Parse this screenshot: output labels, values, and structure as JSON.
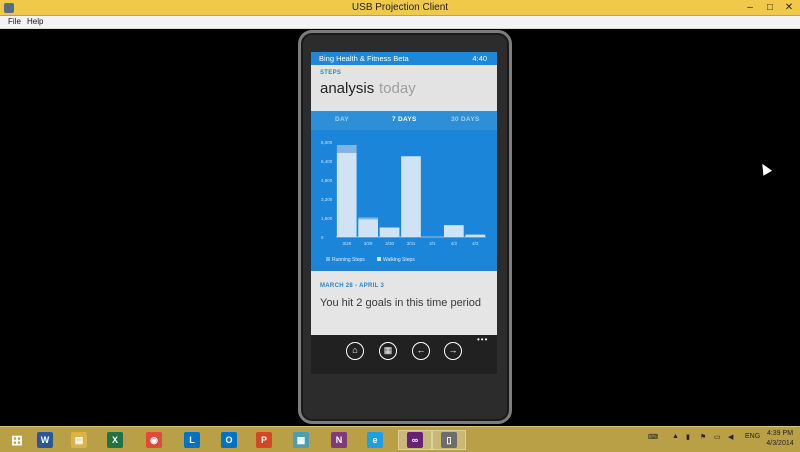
{
  "window": {
    "title": "USB Projection Client",
    "min_glyph": "–",
    "max_glyph": "□",
    "close_glyph": "✕"
  },
  "menu": [
    "File",
    "Help"
  ],
  "phone": {
    "status": {
      "app_name": "Bing Health & Fitness Beta",
      "time": "4:40"
    },
    "section_label": "STEPS",
    "pivot_active": "analysis",
    "pivot_inactive": "today",
    "tabs": [
      "DAY",
      "7 DAYS",
      "30 DAYS"
    ],
    "summary_range": "MARCH 28 - APRIL 3",
    "summary_message": "You hit 2 goals in this time period",
    "app_bar": {
      "icons": [
        "home-icon",
        "calendar-icon",
        "back-arrow-icon",
        "forward-arrow-icon"
      ],
      "more": "•••"
    }
  },
  "chart_data": {
    "type": "bar",
    "categories": [
      "3/28",
      "3/29",
      "3/30",
      "3/31",
      "4/1",
      "4/2",
      "4/3"
    ],
    "series": [
      {
        "name": "Running Steps",
        "values": [
          650,
          150,
          0,
          0,
          0,
          0,
          0
        ]
      },
      {
        "name": "Walking Steps",
        "values": [
          7100,
          1500,
          800,
          6800,
          0,
          1000,
          200
        ]
      }
    ],
    "yticks": [
      "8,000",
      "6,400",
      "4,800",
      "3,200",
      "1,600",
      "0"
    ],
    "ylim": [
      0,
      8000
    ],
    "legend": [
      "Running Steps",
      "Walking Steps"
    ],
    "colors": {
      "running": "#7fb5e6",
      "walking": "#cfe3f4",
      "background": "#1b85d9",
      "axis": "#bcd9f2"
    }
  },
  "taskbar": {
    "apps": [
      {
        "name": "windows-start",
        "glyph": "⊞",
        "color": "transparent"
      },
      {
        "name": "word",
        "glyph": "W",
        "color": "#2b579a"
      },
      {
        "name": "file-explorer",
        "glyph": "▤",
        "color": "#d9b44a"
      },
      {
        "name": "excel",
        "glyph": "X",
        "color": "#217346"
      },
      {
        "name": "chrome",
        "glyph": "◉",
        "color": "#dd4b39"
      },
      {
        "name": "lync",
        "glyph": "L",
        "color": "#0072c6"
      },
      {
        "name": "outlook",
        "glyph": "O",
        "color": "#0072c6"
      },
      {
        "name": "powerpoint",
        "glyph": "P",
        "color": "#d24726"
      },
      {
        "name": "project-app",
        "glyph": "▦",
        "color": "#4b9fb5"
      },
      {
        "name": "onenote",
        "glyph": "N",
        "color": "#80397b"
      },
      {
        "name": "internet-explorer",
        "glyph": "e",
        "color": "#1ba1e2"
      },
      {
        "name": "visual-studio",
        "glyph": "∞",
        "color": "#68217a"
      },
      {
        "name": "usb-projection-client",
        "glyph": "▯",
        "color": "#6d6d6d"
      }
    ],
    "language": "ENG",
    "clock_time": "4:39 PM",
    "clock_date": "4/3/2014"
  }
}
